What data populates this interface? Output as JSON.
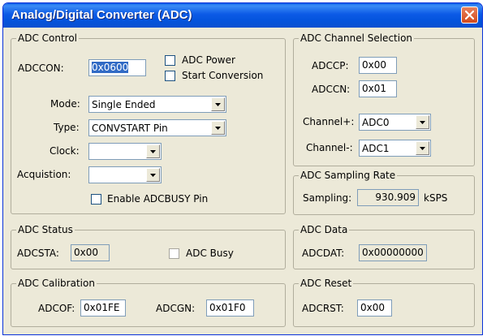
{
  "window": {
    "title": "Analog/Digital Converter (ADC)"
  },
  "adc_control": {
    "legend": "ADC Control",
    "adccon_label": "ADCCON:",
    "adccon_value": "0x0600",
    "adc_power_label": "ADC Power",
    "start_conversion_label": "Start Conversion",
    "mode_label": "Mode:",
    "mode_value": "Single Ended",
    "type_label": "Type:",
    "type_value": "CONVSTART Pin",
    "clock_label": "Clock:",
    "clock_value": "",
    "acquisition_label": "Acquistion:",
    "acquisition_value": "",
    "enable_adcbusy_label": "Enable ADCBUSY Pin"
  },
  "channel_selection": {
    "legend": "ADC Channel Selection",
    "adccp_label": "ADCCP:",
    "adccp_value": "0x00",
    "adccn_label": "ADCCN:",
    "adccn_value": "0x01",
    "channel_plus_label": "Channel+:",
    "channel_plus_value": "ADC0",
    "channel_minus_label": "Channel-:",
    "channel_minus_value": "ADC1"
  },
  "sampling_rate": {
    "legend": "ADC Sampling Rate",
    "sampling_label": "Sampling:",
    "sampling_value": "930.909",
    "unit": "kSPS"
  },
  "adc_status": {
    "legend": "ADC Status",
    "adcsta_label": "ADCSTA:",
    "adcsta_value": "0x00",
    "adc_busy_label": "ADC Busy"
  },
  "adc_data": {
    "legend": "ADC Data",
    "adcdat_label": "ADCDAT:",
    "adcdat_value": "0x00000000"
  },
  "adc_calibration": {
    "legend": "ADC Calibration",
    "adcof_label": "ADCOF:",
    "adcof_value": "0x01FE",
    "adcgn_label": "ADCGN:",
    "adcgn_value": "0x01F0"
  },
  "adc_reset": {
    "legend": "ADC Reset",
    "adcrst_label": "ADCRST:",
    "adcrst_value": "0x00"
  },
  "icons": {
    "close": "close-icon",
    "dropdown": "chevron-down-icon"
  },
  "colors": {
    "titlebar": "#0454dd",
    "close_button": "#d24a1c",
    "dialog_bg": "#ece9d8",
    "selection": "#316ac5"
  }
}
